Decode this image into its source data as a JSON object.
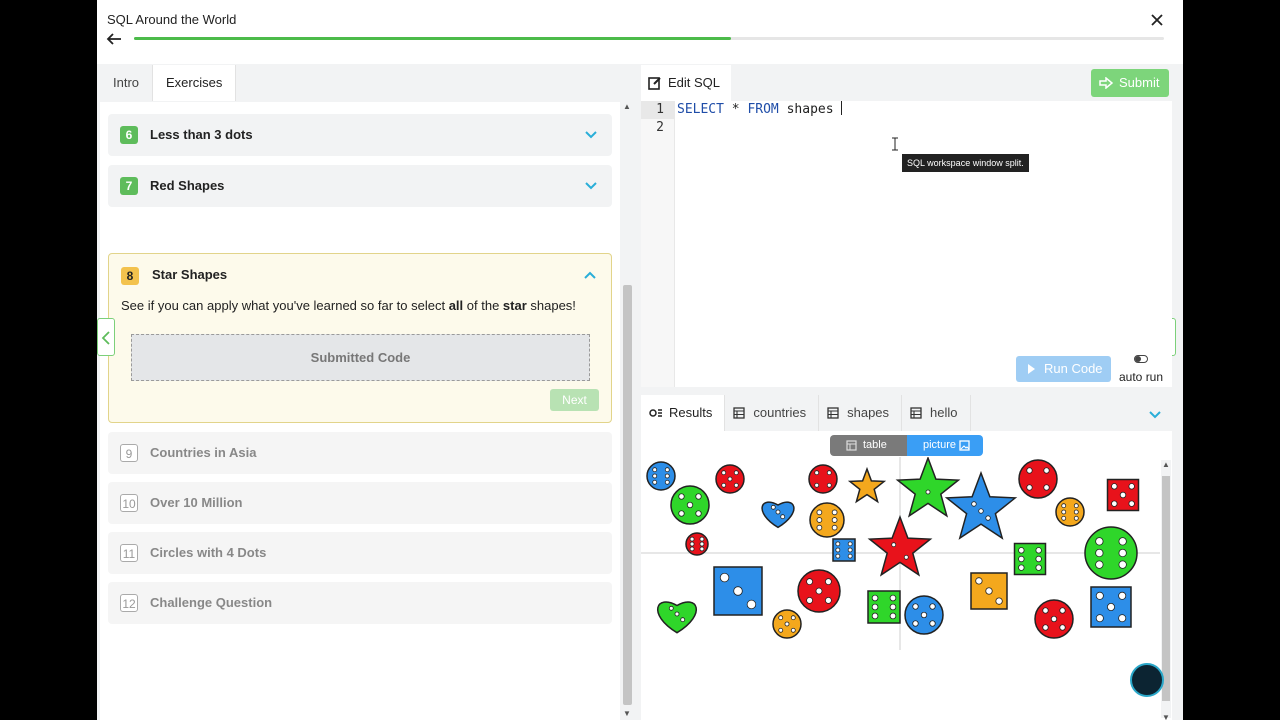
{
  "app": {
    "title": "SQL Around the World",
    "progress_fraction": 0.58
  },
  "left_panel": {
    "tabs": [
      {
        "label": "Intro"
      },
      {
        "label": "Exercises"
      }
    ],
    "exercises": [
      {
        "number": "6",
        "name": "Less than 3 dots",
        "state": "done"
      },
      {
        "number": "7",
        "name": "Red Shapes",
        "state": "done"
      },
      {
        "number": "8",
        "name": "Star Shapes",
        "state": "open",
        "desc_pre": "See if you can apply what you've learned so far to select ",
        "desc_bold1": "all",
        "desc_mid": " of the ",
        "desc_bold2": "star",
        "desc_post": " shapes!",
        "submitted_label": "Submitted Code",
        "next_label": "Next"
      },
      {
        "number": "9",
        "name": "Countries in Asia",
        "state": "locked"
      },
      {
        "number": "10",
        "name": "Over 10 Million",
        "state": "locked"
      },
      {
        "number": "11",
        "name": "Circles with 4 Dots",
        "state": "locked"
      },
      {
        "number": "12",
        "name": "Challenge Question",
        "state": "locked"
      }
    ]
  },
  "editor": {
    "tab_label": "Edit SQL",
    "submit_label": "Submit",
    "line_numbers": [
      "1",
      "2"
    ],
    "code": {
      "kw1": "SELECT",
      "rest1": " * ",
      "kw2": "FROM",
      "rest2": " shapes "
    },
    "tooltip": "SQL workspace window split.",
    "run_label": "Run Code",
    "autorun_label": "auto run"
  },
  "results": {
    "tabs": [
      {
        "label": "Results"
      },
      {
        "label": "countries"
      },
      {
        "label": "shapes"
      },
      {
        "label": "hello"
      }
    ],
    "view_options": {
      "table": "table",
      "picture": "picture",
      "selected": "picture"
    }
  },
  "colors": {
    "green": "#5ebc5b",
    "yellow": "#f3c24d",
    "blue": "#3a9ef5",
    "red": "#e8121b",
    "orange": "#f4a81d",
    "bright_green": "#2fd62a",
    "shape_blue": "#2d8ee8"
  }
}
